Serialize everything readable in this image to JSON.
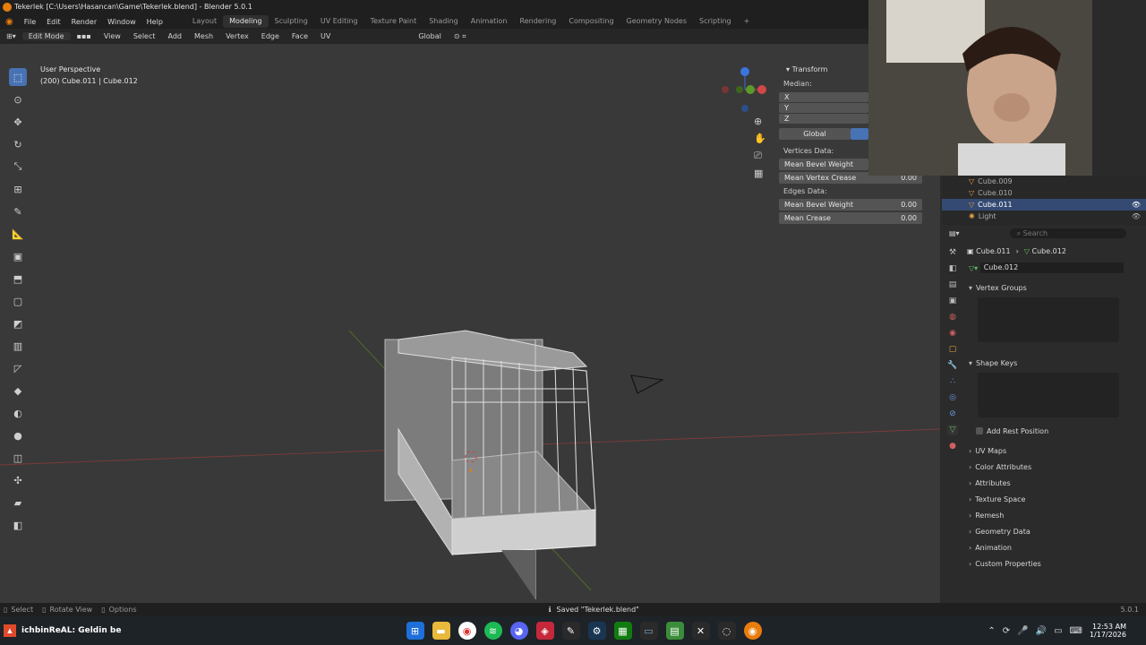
{
  "window": {
    "title": "Tekerlek [C:\\Users\\Hasancan\\Game\\Tekerlek.blend] - Blender 5.0.1"
  },
  "menu": {
    "file": "File",
    "edit": "Edit",
    "render": "Render",
    "window": "Window",
    "help": "Help"
  },
  "workspaces": [
    "Layout",
    "Modeling",
    "Sculpting",
    "UV Editing",
    "Texture Paint",
    "Shading",
    "Animation",
    "Rendering",
    "Compositing",
    "Geometry Nodes",
    "Scripting"
  ],
  "active_workspace": "Modeling",
  "header": {
    "mode": "Edit Mode",
    "view": "View",
    "select": "Select",
    "add": "Add",
    "mesh": "Mesh",
    "vertex": "Vertex",
    "edge": "Edge",
    "face": "Face",
    "uv": "UV",
    "orientation": "Global"
  },
  "viewport": {
    "perspective": "User Perspective",
    "object_info": "(200) Cube.011 | Cube.012"
  },
  "npanel": {
    "transform_title": "Transform",
    "median": "Median:",
    "x": "X",
    "y": "Y",
    "z": "Z",
    "global_label": "Global",
    "vertices_data": "Vertices Data:",
    "mean_bevel_weight_v": "Mean Bevel Weight",
    "mean_vertex_crease": "Mean Vertex Crease",
    "v_crease_value": "0.00",
    "edges_data": "Edges Data:",
    "mean_bevel_weight_e": "Mean Bevel Weight",
    "mean_bevel_weight_e_value": "0.00",
    "mean_crease": "Mean Crease",
    "mean_crease_value": "0.00"
  },
  "outliner": {
    "items": [
      "Cube.009",
      "Cube.010",
      "Cube.011",
      "Light"
    ],
    "selected": "Cube.011"
  },
  "properties": {
    "search_placeholder": "Search",
    "breadcrumb_object": "Cube.011",
    "breadcrumb_mesh": "Cube.012",
    "mesh_name": "Cube.012",
    "sections": [
      "Vertex Groups",
      "Shape Keys"
    ],
    "add_rest_position": "Add Rest Position",
    "collapsed": [
      "UV Maps",
      "Color Attributes",
      "Attributes",
      "Texture Space",
      "Remesh",
      "Geometry Data",
      "Animation",
      "Custom Properties"
    ]
  },
  "statusbar": {
    "select": "Select",
    "rotate": "Rotate View",
    "options": "Options",
    "message": "Saved \"Tekerlek.blend\"",
    "version": "5.0.1"
  },
  "taskbar": {
    "chat": "ichbinReAL: Geldin be",
    "time": "12:53 AM",
    "date": "1/17/2026"
  },
  "colors": {
    "accent": "#4772b3",
    "selected_row": "#344a72",
    "orange": "#e87d0d"
  }
}
